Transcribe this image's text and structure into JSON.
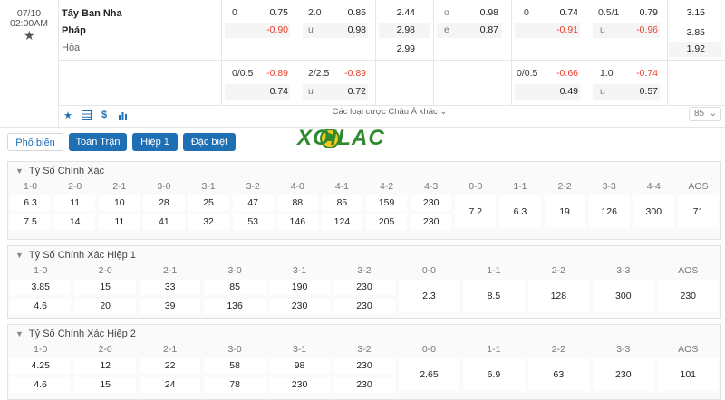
{
  "match": {
    "date": "07/10",
    "time": "02:00AM",
    "team_home": "Tây Ban Nha",
    "team_away": "Pháp",
    "draw_label": "Hòa"
  },
  "odds": {
    "ft_hdp": {
      "r1": [
        "0",
        "0.75"
      ],
      "r2": [
        "",
        "-0.90"
      ],
      "r3": [
        "0/0.5",
        "-0.89"
      ],
      "r4": [
        "",
        "0.74"
      ]
    },
    "ft_ou": {
      "r1": [
        "2.0",
        "0.85"
      ],
      "r2": [
        "u",
        "0.98"
      ],
      "r3": [
        "2/2.5",
        "-0.89"
      ],
      "r4": [
        "u",
        "0.72"
      ]
    },
    "ft_1x2": [
      "2.44",
      "2.98",
      "2.99"
    ],
    "ft_oe": {
      "r1": [
        "o",
        "0.98"
      ],
      "r2": [
        "e",
        "0.87"
      ]
    },
    "h1_hdp": {
      "r1": [
        "0",
        "0.74"
      ],
      "r2": [
        "",
        "-0.91"
      ],
      "r3": [
        "0/0.5",
        "-0.66"
      ],
      "r4": [
        "",
        "0.49"
      ]
    },
    "h1_ou": {
      "r1": [
        "0.5/1",
        "0.79"
      ],
      "r2": [
        "u",
        "-0.96"
      ],
      "r3": [
        "1.0",
        "-0.74"
      ],
      "r4": [
        "u",
        "0.57"
      ]
    },
    "h1_1x2": [
      "3.15",
      "3.85",
      "1.92"
    ]
  },
  "toolbar": {
    "more_label": "Các loại cược Châu Á khác",
    "zoom_value": "85"
  },
  "tabs": [
    "Phổ biến",
    "Toàn Trận",
    "Hiệp 1",
    "Đặc biệt"
  ],
  "logo_text": "XOILAC",
  "sections": [
    {
      "title": "Tỷ Số Chính Xác",
      "headers": [
        "1-0",
        "2-0",
        "2-1",
        "3-0",
        "3-1",
        "3-2",
        "4-0",
        "4-1",
        "4-2",
        "4-3",
        "0-0",
        "1-1",
        "2-2",
        "3-3",
        "4-4",
        "AOS"
      ],
      "row1": [
        "6.3",
        "11",
        "10",
        "28",
        "25",
        "47",
        "88",
        "85",
        "159",
        "230"
      ],
      "row2": [
        "7.5",
        "14",
        "11",
        "41",
        "32",
        "53",
        "146",
        "124",
        "205",
        "230"
      ],
      "draws": [
        "7.2",
        "6.3",
        "19",
        "126",
        "300",
        "71"
      ]
    },
    {
      "title": "Tỷ Số Chính Xác Hiệp 1",
      "headers": [
        "1-0",
        "2-0",
        "2-1",
        "3-0",
        "3-1",
        "3-2",
        "0-0",
        "1-1",
        "2-2",
        "3-3",
        "AOS"
      ],
      "row1": [
        "3.85",
        "15",
        "33",
        "85",
        "190",
        "230"
      ],
      "row2": [
        "4.6",
        "20",
        "39",
        "136",
        "230",
        "230"
      ],
      "draws": [
        "2.3",
        "8.5",
        "128",
        "300",
        "230"
      ]
    },
    {
      "title": "Tỷ Số Chính Xác Hiệp 2",
      "headers": [
        "1-0",
        "2-0",
        "2-1",
        "3-0",
        "3-1",
        "3-2",
        "0-0",
        "1-1",
        "2-2",
        "3-3",
        "AOS"
      ],
      "row1": [
        "4.25",
        "12",
        "22",
        "58",
        "98",
        "230"
      ],
      "row2": [
        "4.6",
        "15",
        "24",
        "78",
        "230",
        "230"
      ],
      "draws": [
        "2.65",
        "6.9",
        "63",
        "230",
        "101"
      ]
    }
  ],
  "colors": {
    "accent": "#1f6fb5",
    "negative": "#e8422b"
  }
}
